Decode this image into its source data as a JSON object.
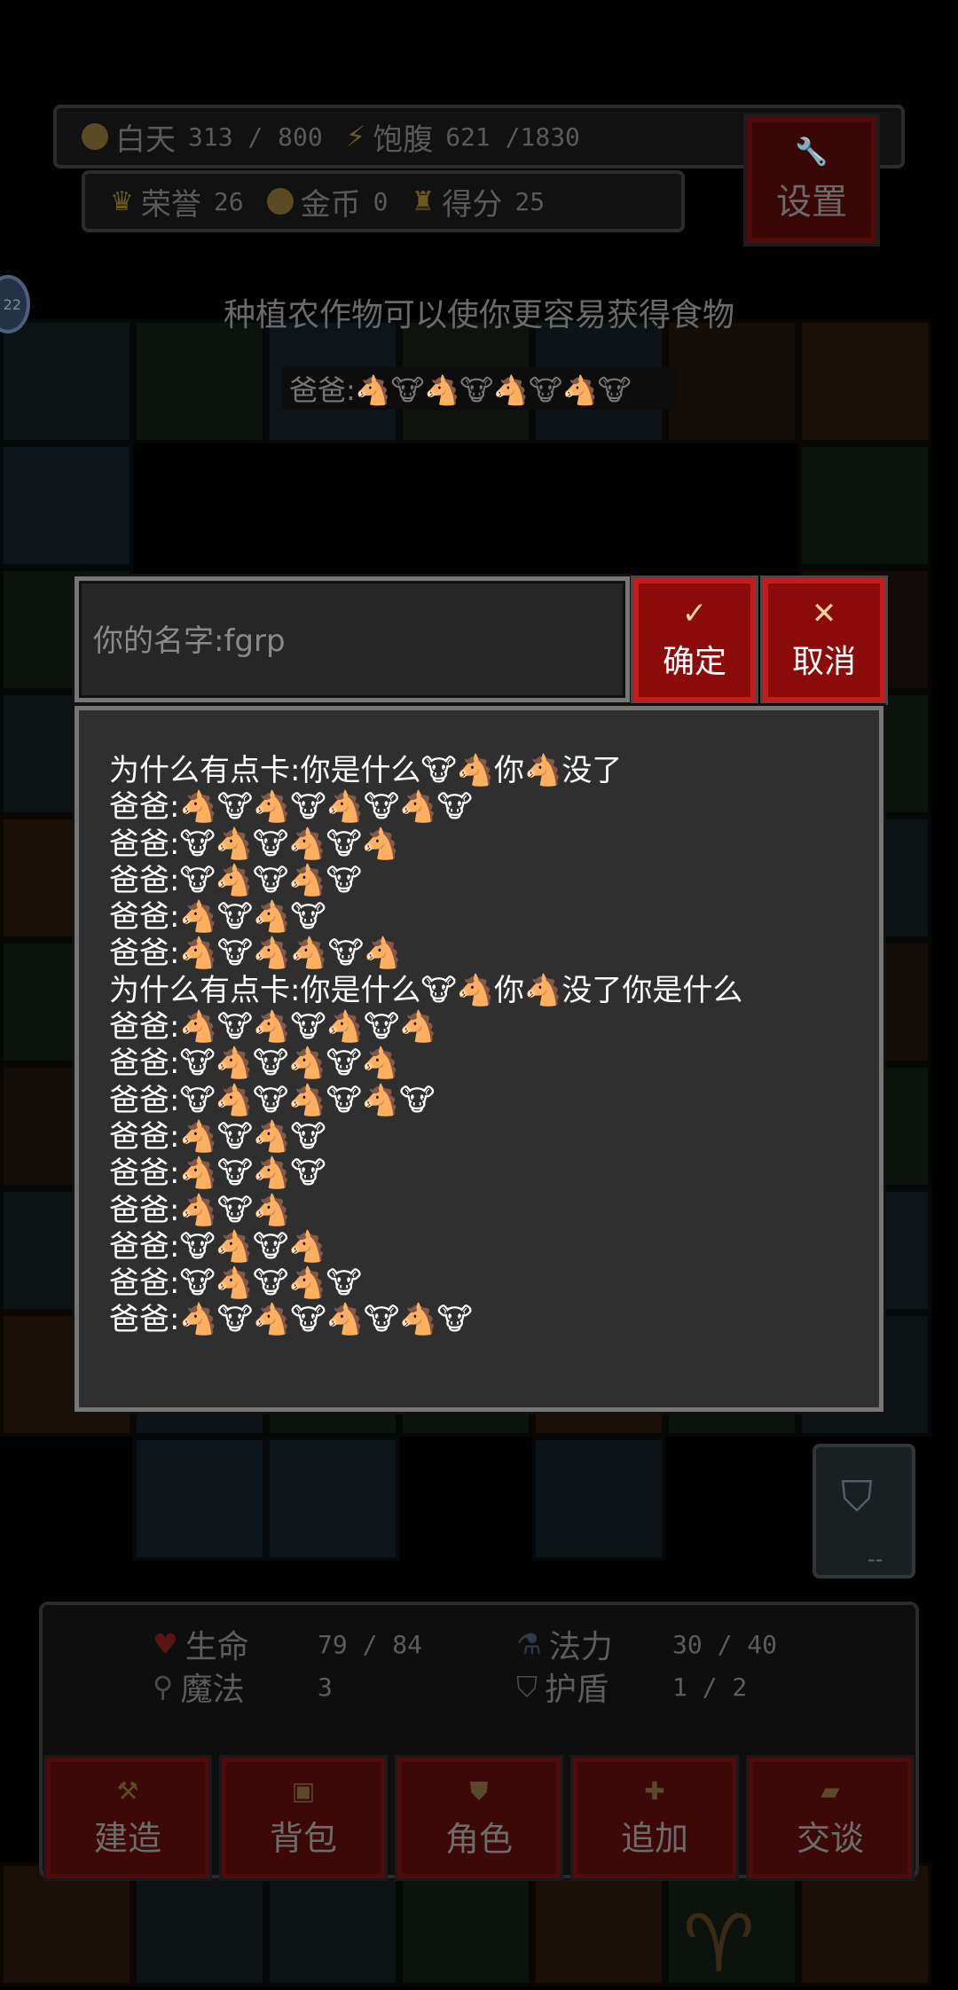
{
  "hud": {
    "day_label": "白天",
    "day_value": "313 / 800",
    "hunger_label": "饱腹",
    "hunger_value": "621 /1830",
    "honor_label": "荣誉",
    "honor_value": "26",
    "gold_label": "金币",
    "gold_value": "0",
    "score_label": "得分",
    "score_value": "25",
    "settings_label": "设置",
    "badge_value": "22"
  },
  "tip": "种植农作物可以使你更容易获得食物",
  "banner": "爸爸:🐴🐮🐴🐮🐴🐮🐴🐮",
  "dialog": {
    "name_placeholder": "你的名字:fgrp",
    "confirm_label": "确定",
    "cancel_label": "取消",
    "messages": [
      "为什么有点卡:你是什么🐮🐴你🐴没了",
      "爸爸:🐴🐮🐴🐮🐴🐮🐴🐮",
      "爸爸:🐮🐴🐮🐴🐮🐴",
      "爸爸:🐮🐴🐮🐴🐮",
      "爸爸:🐴🐮🐴🐮",
      "爸爸:🐴🐮🐴🐴🐮🐴",
      "为什么有点卡:你是什么🐮🐴你🐴没了你是什么",
      "爸爸:🐴🐮🐴🐮🐴🐮🐴",
      "爸爸:🐮🐴🐮🐴🐮🐴",
      "爸爸:🐮🐴🐮🐴🐮🐴🐮",
      "爸爸:🐴🐮🐴🐮",
      "爸爸:🐴🐮🐴🐮",
      "爸爸:🐴🐮🐴",
      "爸爸:🐮🐴🐮🐴",
      "爸爸:🐮🐴🐮🐴🐮",
      "爸爸:🐴🐮🐴🐮🐴🐮🐴🐮"
    ]
  },
  "stats": {
    "hp_label": "生命",
    "hp_value": "79 / 84",
    "mp_label": "法力",
    "mp_value": "30 / 40",
    "magic_label": "魔法",
    "magic_value": "3",
    "shield_label": "护盾",
    "shield_value": "1 / 2"
  },
  "actions": {
    "build": "建造",
    "bag": "背包",
    "role": "角色",
    "add": "追加",
    "talk": "交谈"
  },
  "side_slot": {
    "value": "--"
  },
  "colors": {
    "button_red": "#8c0c0c",
    "button_border": "#c41c1c",
    "panel_bg": "#2f2f2f"
  }
}
